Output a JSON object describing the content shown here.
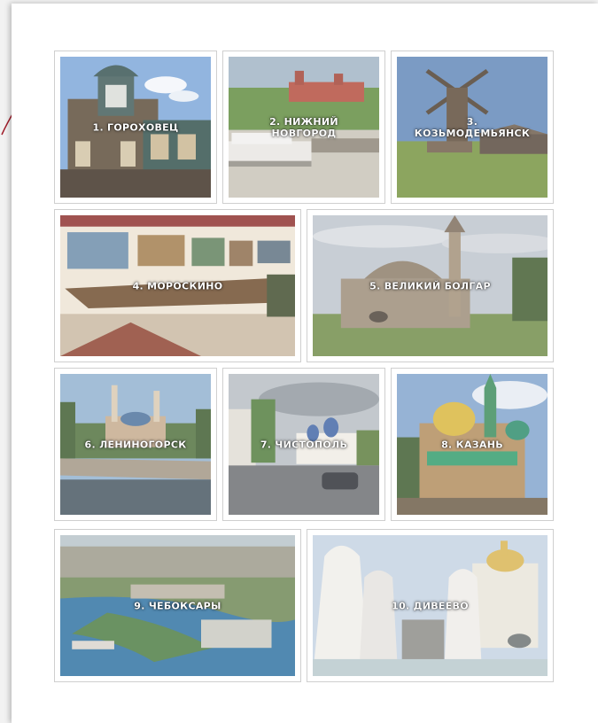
{
  "destinations": [
    {
      "label": "1. ГОРОХОВЕЦ"
    },
    {
      "label": "2. НИЖНИЙ\nНОВГОРОД"
    },
    {
      "label": "3.\nКОЗЬМОДЕМЬЯНСК"
    },
    {
      "label": "4. МОРОСКИНО"
    },
    {
      "label": "5. ВЕЛИКИЙ БОЛГАР"
    },
    {
      "label": "6. ЛЕНИНОГОРСК"
    },
    {
      "label": "7. ЧИСТОПОЛЬ"
    },
    {
      "label": "8. КАЗАНЬ"
    },
    {
      "label": "9. ЧЕБОКСАРЫ"
    },
    {
      "label": "10. ДИВЕЕВО"
    }
  ],
  "colors": {
    "accent_curve": "#a01d2a",
    "caption_text": "#ffffff"
  }
}
